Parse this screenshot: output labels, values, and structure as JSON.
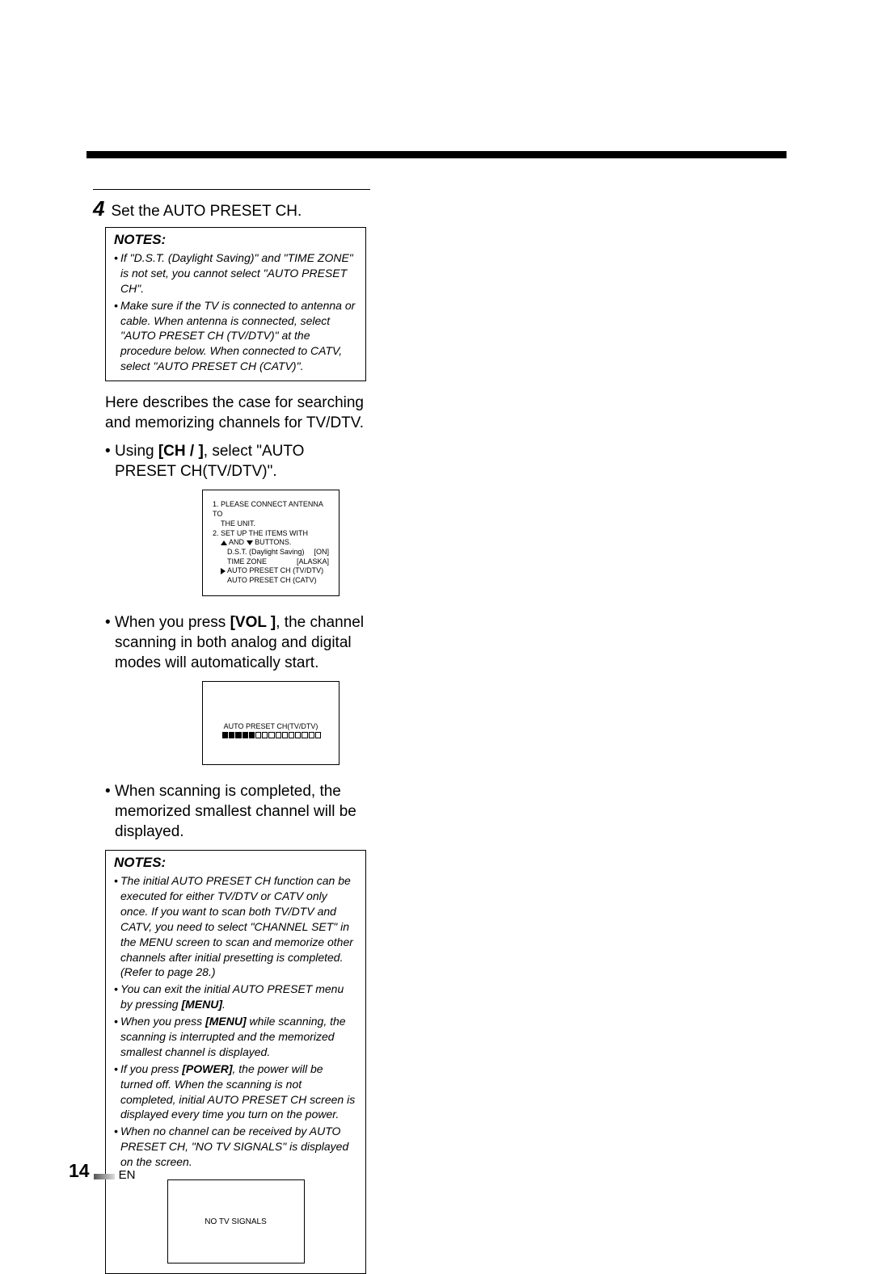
{
  "step": {
    "num": "4",
    "text": "Set the AUTO PRESET CH."
  },
  "notes1": {
    "title": "NOTES:",
    "items": [
      "If \"D.S.T. (Daylight Saving)\" and \"TIME ZONE\" is not set, you cannot select \"AUTO PRESET CH\".",
      "Make sure if the TV is connected to antenna or cable. When antenna is connected, select \"AUTO PRESET CH (TV/DTV)\" at the procedure below.  When connected to CATV, select \"AUTO PRESET CH (CATV)\"."
    ]
  },
  "para1": "Here describes the case for searching and memorizing channels for TV/DTV.",
  "line1_a": "Using ",
  "line1_b": "[CH    /   ]",
  "line1_c": ", select \"AUTO PRESET CH(TV/DTV)\".",
  "osd1": {
    "l1": "1. PLEASE CONNECT ANTENNA TO",
    "l2": "THE UNIT.",
    "l3a": "2. SET UP THE ITEMS WITH",
    "l3b": "AND",
    "l3c": "BUTTONS.",
    "l4a": "D.S.T. (Daylight Saving)",
    "l4b": "[ON]",
    "l5a": "TIME ZONE",
    "l5b": "[ALASKA]",
    "l6": "AUTO PRESET CH (TV/DTV)",
    "l7": "AUTO PRESET CH (CATV)"
  },
  "line2_a": "When you press ",
  "line2_b": "[VOL    ]",
  "line2_c": ", the channel scanning in both analog and digital modes will automatically start.",
  "osd2": {
    "label": "AUTO PRESET CH(TV/DTV)"
  },
  "line3": "When scanning is completed, the memorized smallest channel will be displayed.",
  "notes2": {
    "title": "NOTES:",
    "items": [
      {
        "pre": "The initial AUTO PRESET CH function can be executed for either TV/DTV or CATV only once. If you want to scan both TV/DTV and CATV, you need to select \"CHANNEL SET\" in the MENU screen to scan and memorize other channels after initial presetting is completed. (Refer to page 28.)"
      },
      {
        "pre": "You can exit the initial AUTO PRESET menu by pressing ",
        "bold": "[MENU]",
        "post": "."
      },
      {
        "pre": "When you press ",
        "bold": "[MENU]",
        "post": " while scanning, the scanning is interrupted and the memorized smallest channel is displayed."
      },
      {
        "pre": "If you press ",
        "bold": "[POWER]",
        "post": ", the power will be turned off. When the scanning is not completed, initial AUTO PRESET CH screen is displayed every time you turn on the power."
      },
      {
        "pre": "When no channel can be received by AUTO PRESET CH, \"NO TV SIGNALS\" is displayed on the screen."
      }
    ]
  },
  "osd3": {
    "label": "NO TV SIGNALS"
  },
  "footer": {
    "page": "14",
    "lang": "EN"
  }
}
